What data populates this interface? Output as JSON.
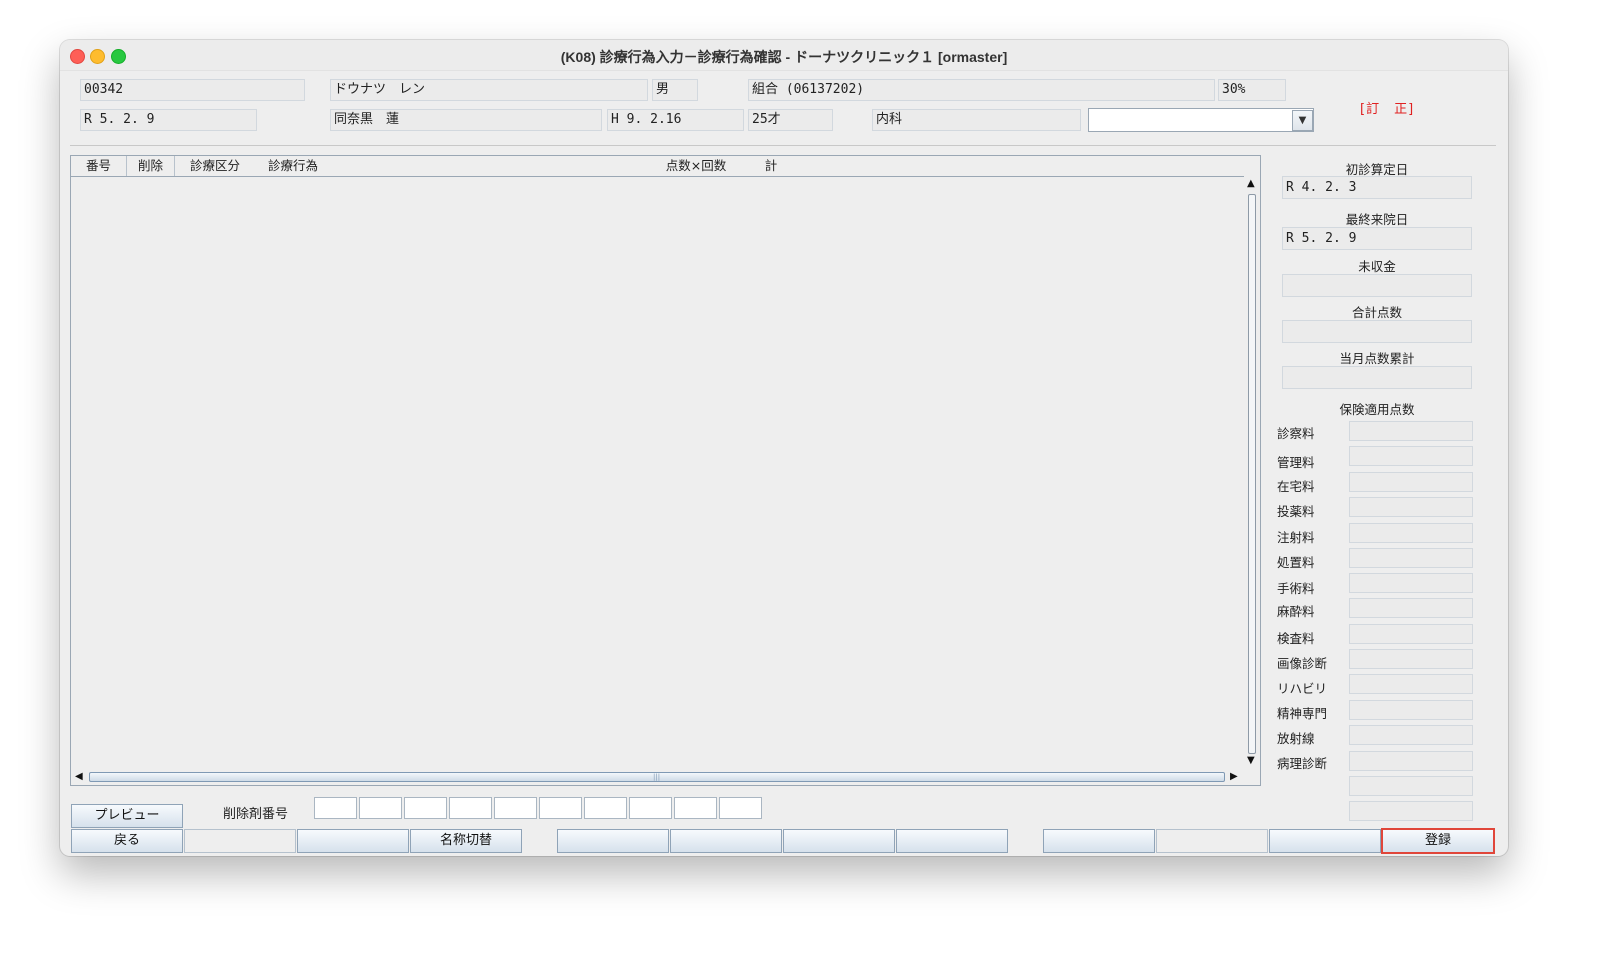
{
  "window": {
    "title": "(K08) 診療行為入力－診療行為確認 - ドーナツクリニック１ [ormaster]"
  },
  "patient": {
    "id": "00342",
    "kana_name": "ドウナツ　レン",
    "sex": "男",
    "insurance": "組合 (06137202)",
    "ratio": "30%",
    "visit_date": "R 5. 2. 9",
    "kanji_name": "同奈黒　蓮",
    "birth_date": "H 9. 2.16",
    "age": "25才",
    "department": "内科",
    "selector_value": ""
  },
  "mode_label": "[訂　正]",
  "table": {
    "columns": [
      "番号",
      "削除",
      "診療区分",
      "診療行為",
      "点数×回数",
      "計"
    ],
    "rows": []
  },
  "side": {
    "first_visit_label": "初診算定日",
    "first_visit_value": "R 4. 2. 3",
    "last_visit_label": "最終来院日",
    "last_visit_value": "R 5. 2. 9",
    "unpaid_label": "未収金",
    "unpaid_value": "",
    "total_points_label": "合計点数",
    "total_points_value": "",
    "month_points_label": "当月点数累計",
    "month_points_value": "",
    "insurance_points_label": "保険適用点数",
    "fees": [
      {
        "label": "診察料",
        "value": ""
      },
      {
        "label": "管理料",
        "value": ""
      },
      {
        "label": "在宅料",
        "value": ""
      },
      {
        "label": "投薬料",
        "value": ""
      },
      {
        "label": "注射料",
        "value": ""
      },
      {
        "label": "処置料",
        "value": ""
      },
      {
        "label": "手術料",
        "value": ""
      },
      {
        "label": "麻酔料",
        "value": ""
      },
      {
        "label": "検査料",
        "value": ""
      },
      {
        "label": "画像診断",
        "value": ""
      },
      {
        "label": "リハビリ",
        "value": ""
      },
      {
        "label": "精神専門",
        "value": ""
      },
      {
        "label": "放射線",
        "value": ""
      },
      {
        "label": "病理診断",
        "value": ""
      },
      {
        "label": "",
        "value": ""
      },
      {
        "label": "",
        "value": ""
      }
    ]
  },
  "bottom": {
    "preview_label": "プレビュー",
    "delete_number_label": "削除剤番号",
    "back_label": "戻る",
    "name_switch_label": "名称切替",
    "register_label": "登録"
  }
}
